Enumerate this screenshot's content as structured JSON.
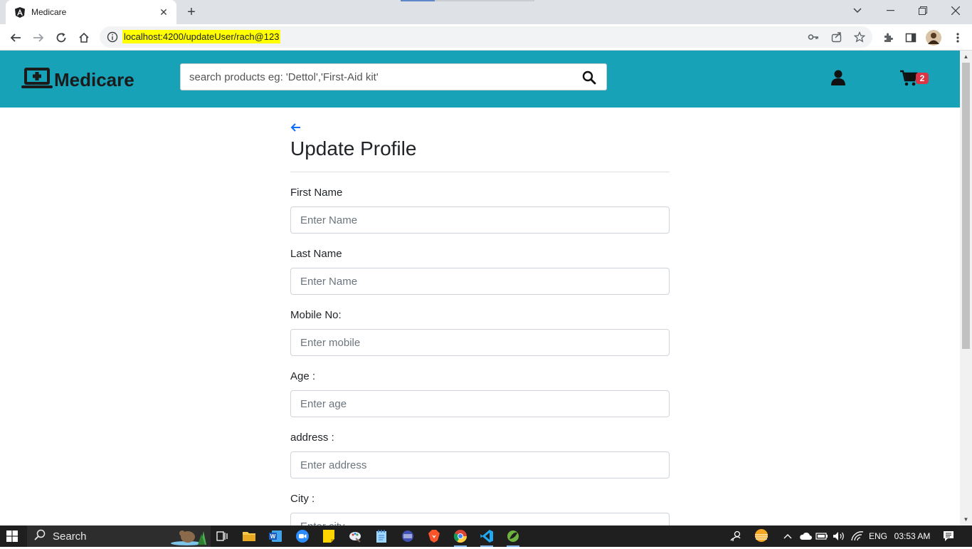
{
  "browser": {
    "tab_title": "Medicare",
    "url": "localhost:4200/updateUser/rach@123"
  },
  "header": {
    "brand": "Medicare",
    "search_placeholder": "search products eg: 'Dettol','First-Aid kit'",
    "cart_count": "2",
    "accent_color": "#17a2b8",
    "badge_color": "#dc3545"
  },
  "page": {
    "title": "Update Profile",
    "fields": [
      {
        "label": "First Name",
        "placeholder": "Enter Name"
      },
      {
        "label": "Last Name",
        "placeholder": "Enter Name"
      },
      {
        "label": "Mobile No:",
        "placeholder": "Enter mobile"
      },
      {
        "label": "Age :",
        "placeholder": "Enter age"
      },
      {
        "label": "address :",
        "placeholder": "Enter address"
      },
      {
        "label": "City :",
        "placeholder": "Enter city"
      }
    ]
  },
  "taskbar": {
    "search_label": "Search",
    "language": "ENG",
    "time": "03:53 AM"
  },
  "icons": {
    "back": "arrow-left-icon",
    "search": "search-icon",
    "user": "user-icon",
    "cart": "cart-icon",
    "brand": "medical-laptop-icon"
  }
}
